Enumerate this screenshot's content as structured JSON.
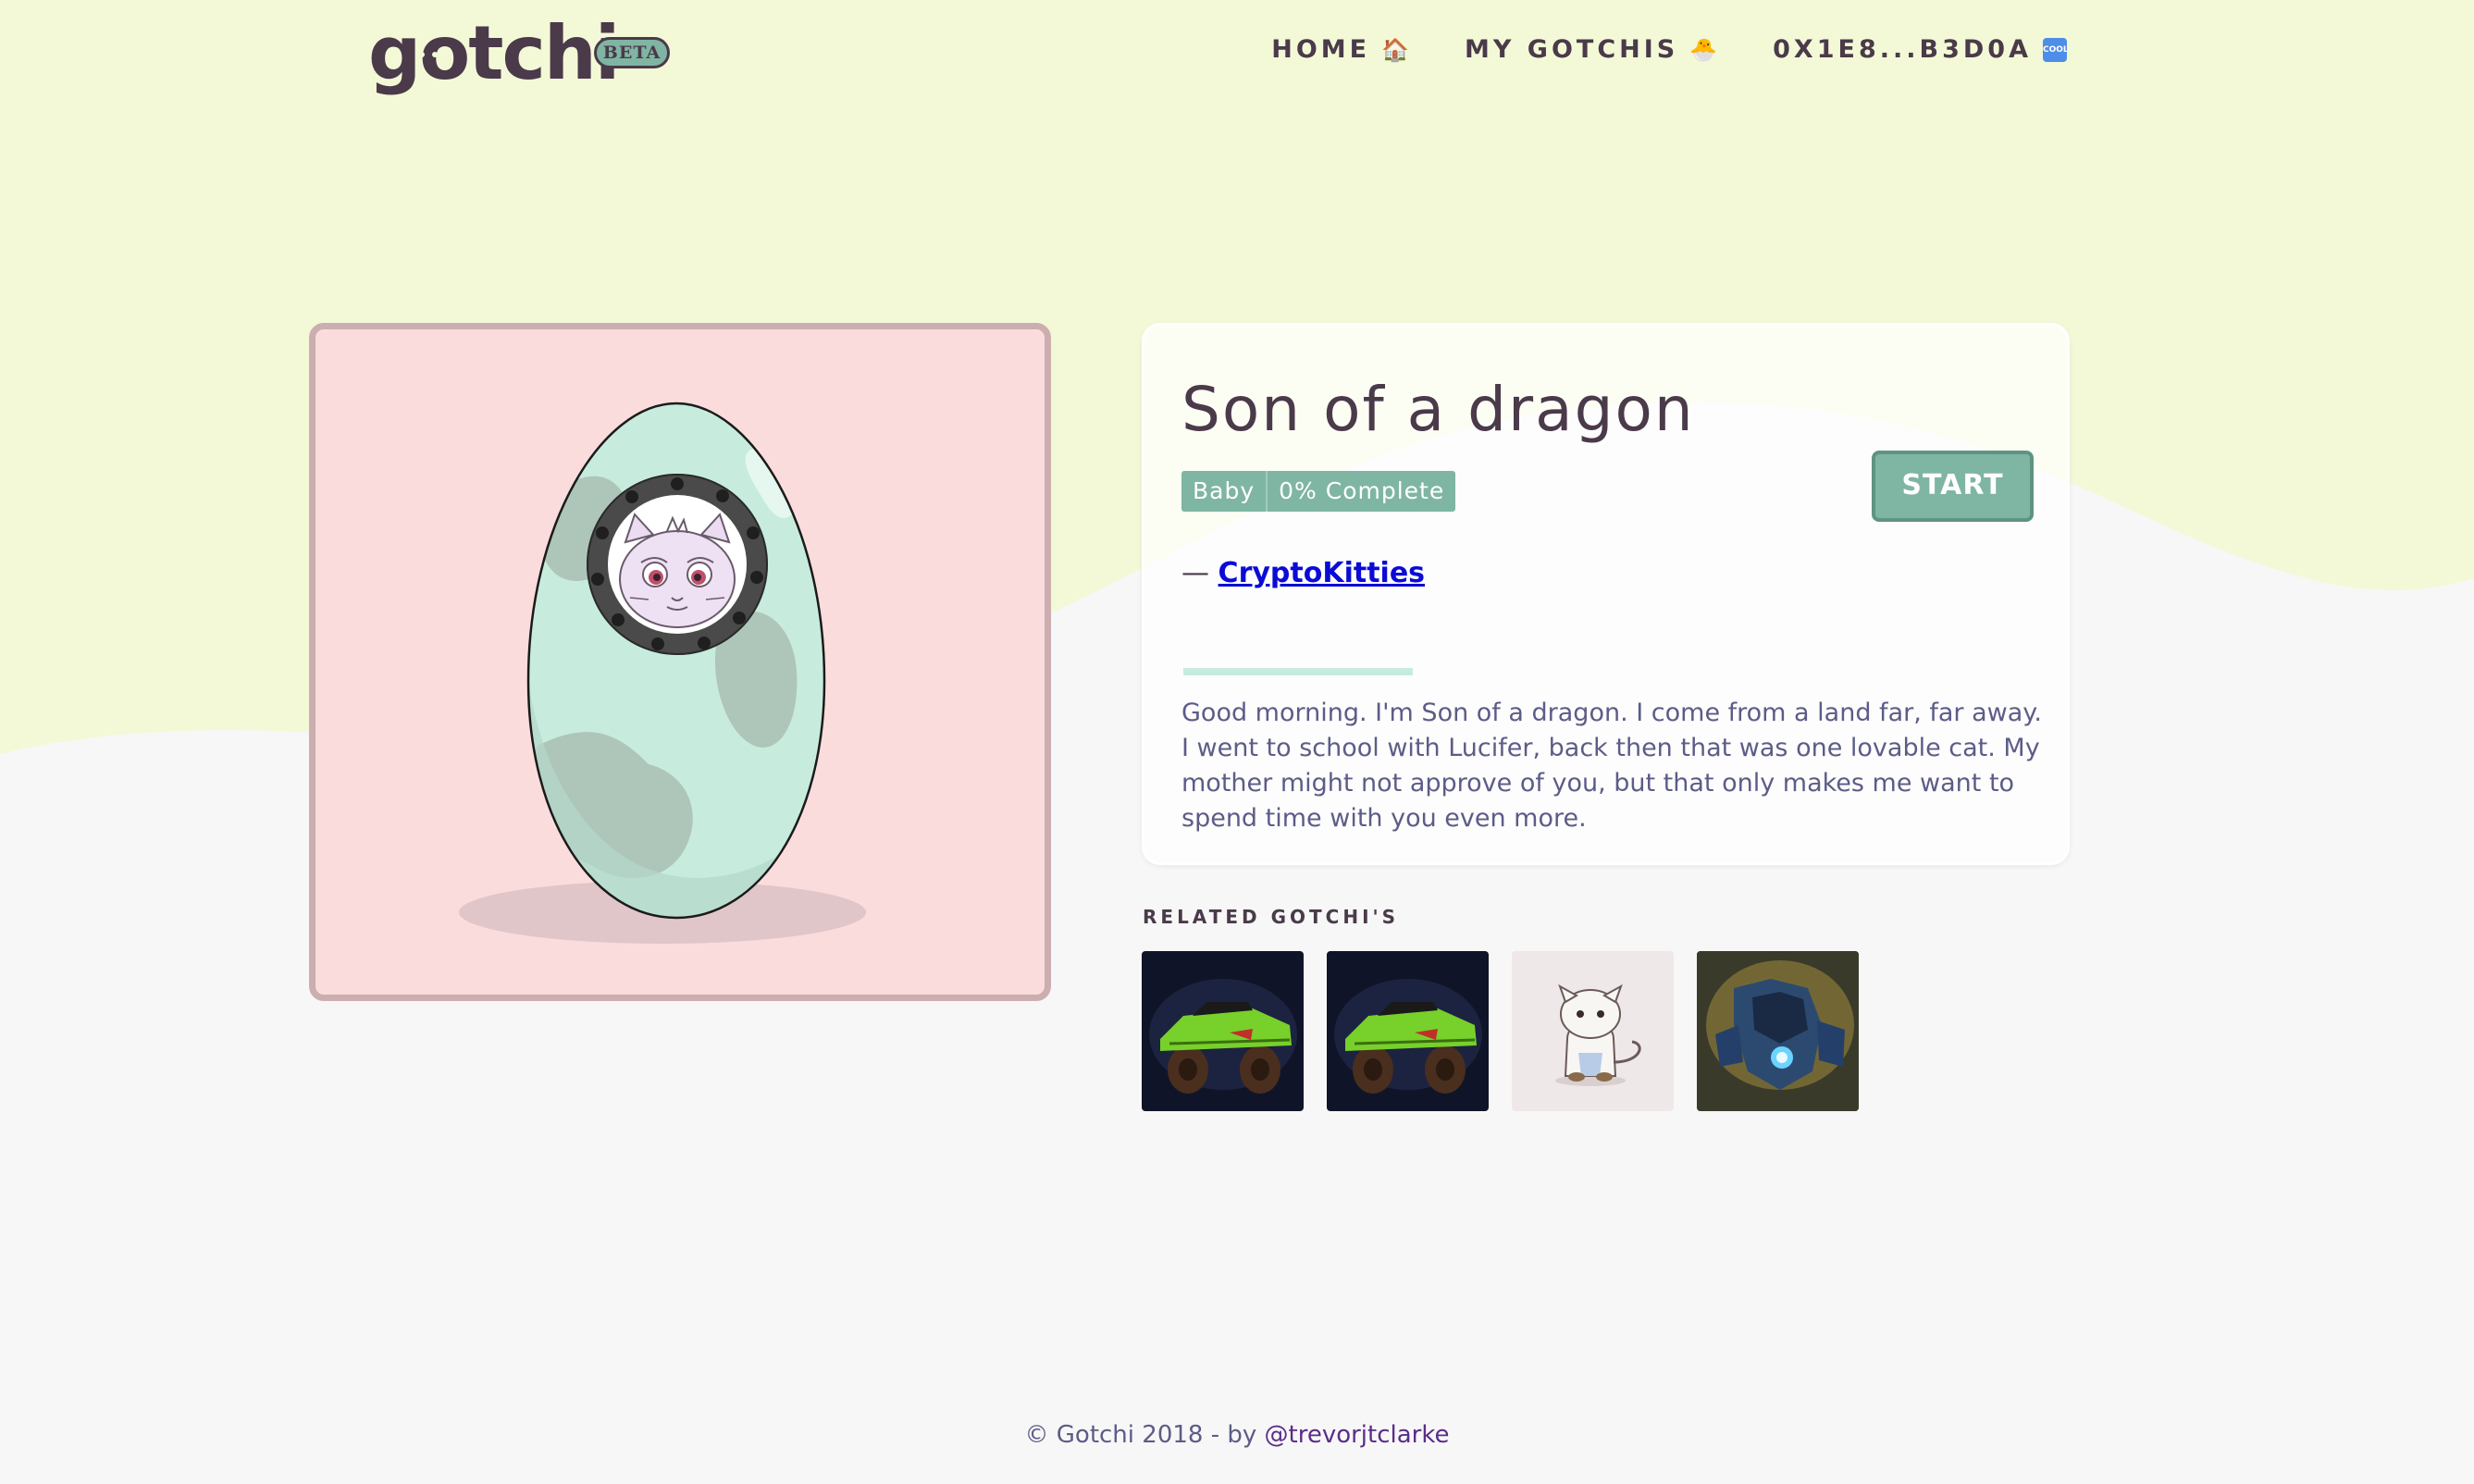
{
  "header": {
    "logo_text": "gotchi",
    "beta_label": "BETA",
    "nav": {
      "home_label": "HOME",
      "home_icon": "house-emoji",
      "my_gotchis_label": "MY GOTCHIS",
      "my_gotchis_icon": "hatching-chick-emoji",
      "wallet_label": "0X1E8...B3D0A",
      "wallet_icon": "cool-button-emoji"
    }
  },
  "gotchi": {
    "name": "Son of a dragon",
    "stage": "Baby",
    "progress_label": "0% Complete",
    "progress": 0,
    "start_label": "START",
    "attribution_prefix": "—",
    "attribution_link": "CryptoKitties",
    "description": "Good morning. I'm Son of a dragon. I come from a land far, far away. I went to school with Lucifer, back then that was one lovable cat. My mother might not approve of you, but that only makes me want to spend time with you even more."
  },
  "related": {
    "title": "RELATED GOTCHI'S",
    "items": [
      {
        "image": "green-monster-truck"
      },
      {
        "image": "green-monster-truck"
      },
      {
        "image": "cryptokitty-white"
      },
      {
        "image": "blue-armored-robot"
      }
    ]
  },
  "footer": {
    "text": "© Gotchi 2018 - by ",
    "author_link": "@trevorjtclarke"
  },
  "colors": {
    "lime_background": "#f3f9d6",
    "page_background": "#f7f7f7",
    "egg_panel_background": "#fbdcdd",
    "egg_shell": "#c7ecdd",
    "accent_green": "#7fb5a3",
    "text_dark": "#4a3a4a",
    "text_body": "#5c5c88",
    "link_blue": "#0b0bd6"
  }
}
